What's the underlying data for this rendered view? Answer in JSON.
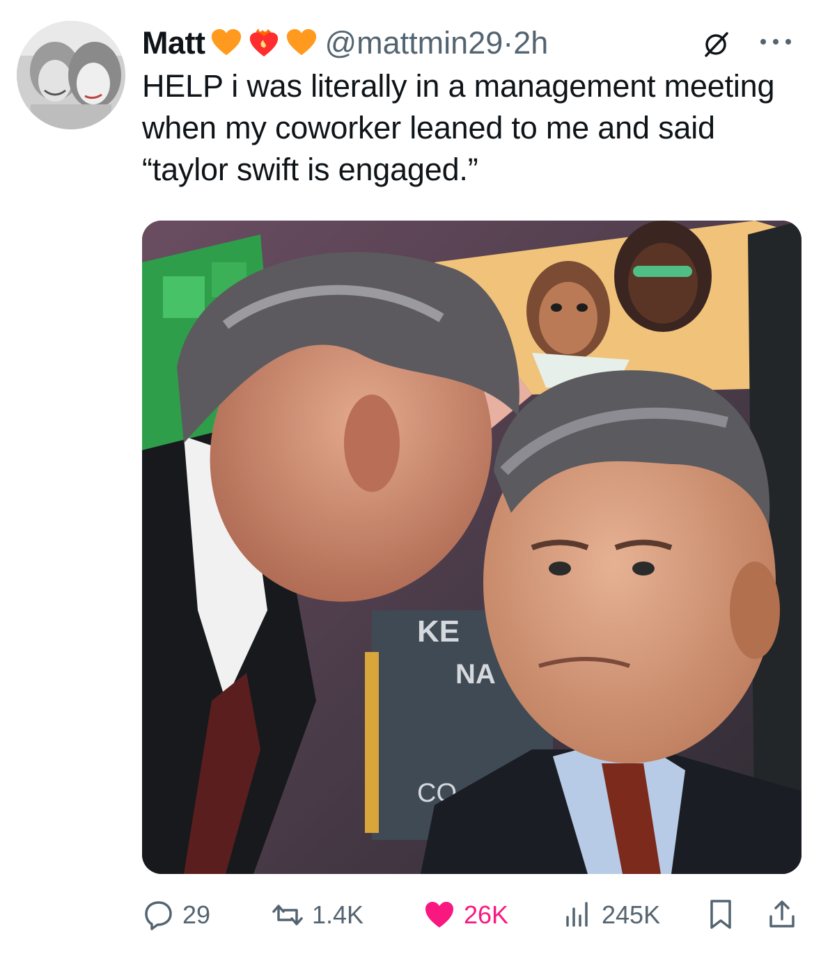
{
  "tweet": {
    "author_name": "Matt",
    "emojis": [
      "orange-heart-icon",
      "heart-on-fire-icon",
      "orange-heart-icon"
    ],
    "handle": "@mattmin29",
    "separator": "·",
    "time": "2h",
    "text": "HELP i was literally in a management meeting when my coworker leaned to me and said “taylor swift is engaged.”",
    "media_text": [
      "KE",
      "NA",
      "CO"
    ]
  },
  "actions": {
    "replies": "29",
    "retweets": "1.4K",
    "likes": "26K",
    "views": "245K"
  },
  "colors": {
    "text": "#0f1419",
    "secondary": "#536471",
    "like": "#f91880",
    "emoji_heart": "#ff9a1f",
    "emoji_fire": "#ff3b30"
  }
}
